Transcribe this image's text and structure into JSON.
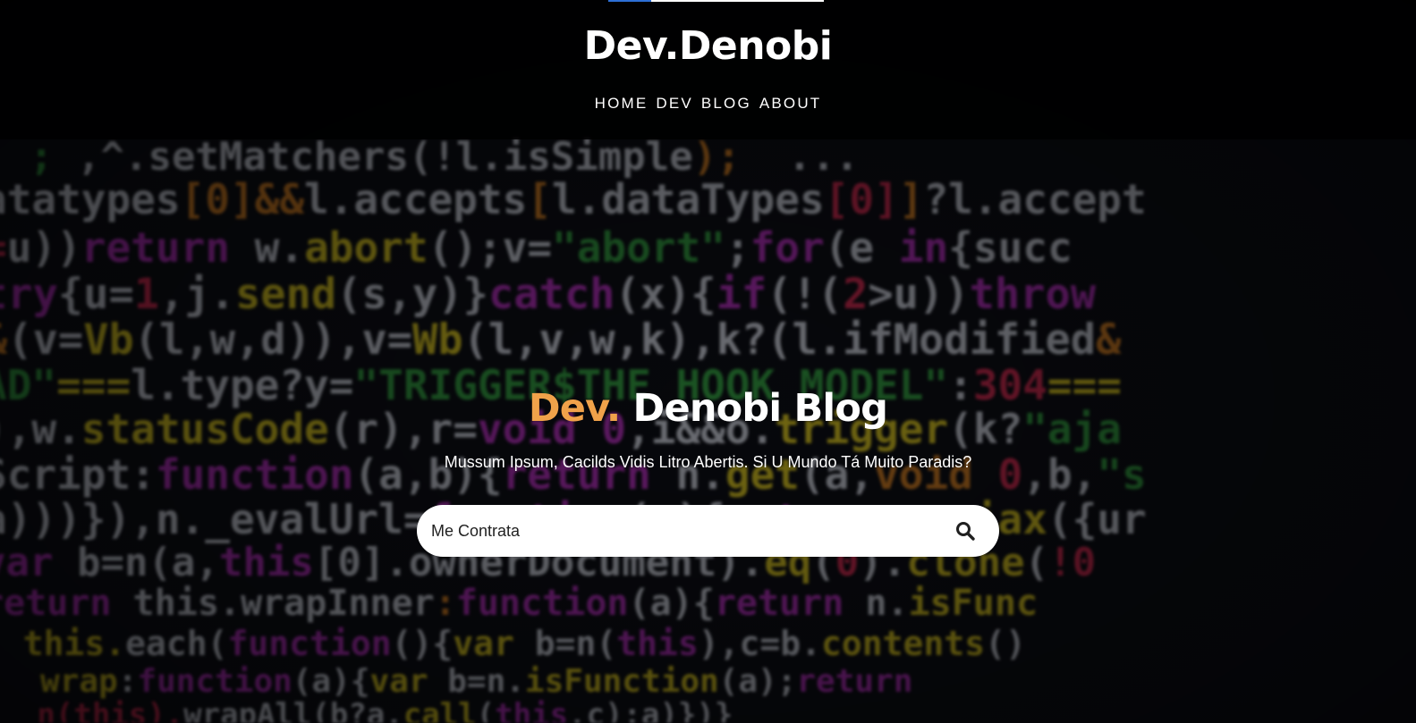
{
  "site": {
    "logo": "Dev.Denobi"
  },
  "nav": {
    "items": [
      {
        "label": "HOME"
      },
      {
        "label": "DEV"
      },
      {
        "label": "BLOG"
      },
      {
        "label": "ABOUT"
      }
    ]
  },
  "hero": {
    "title_accent": "Dev.",
    "title_main": " Denobi Blog",
    "subtitle": "Mussum Ipsum, Cacilds Vidis Litro Abertis. Si U Mundo Tá Muito Paradis?"
  },
  "search": {
    "value": "Me Contrata",
    "icon": "search-icon"
  },
  "colors": {
    "accent": "#f0a24a",
    "header_bar_accent": "#2d6fd6"
  }
}
